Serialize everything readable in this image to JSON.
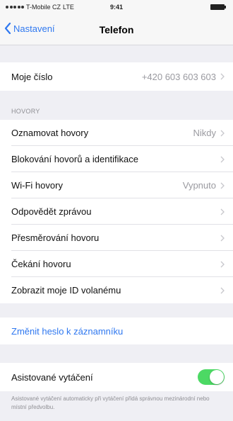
{
  "status": {
    "carrier": "T-Mobile CZ",
    "network": "LTE",
    "time": "9:41"
  },
  "nav": {
    "back_label": "Nastavení",
    "title": "Telefon"
  },
  "my_number": {
    "label": "Moje číslo",
    "value": "+420 603 603 603"
  },
  "calls_section": {
    "header": "HOVORY",
    "items": [
      {
        "label": "Oznamovat hovory",
        "value": "Nikdy"
      },
      {
        "label": "Blokování hovorů a identifikace",
        "value": ""
      },
      {
        "label": "Wi-Fi hovory",
        "value": "Vypnuto"
      },
      {
        "label": "Odpovědět zprávou",
        "value": ""
      },
      {
        "label": "Přesměrování hovoru",
        "value": ""
      },
      {
        "label": "Čekání hovoru",
        "value": ""
      },
      {
        "label": "Zobrazit moje ID volanému",
        "value": ""
      }
    ]
  },
  "voicemail": {
    "label": "Změnit heslo k záznamníku"
  },
  "assisted_dialing": {
    "label": "Asistované vytáčení",
    "enabled": true,
    "footnote": "Asistované vytáčení automaticky při vytáčení přidá správnou mezinárodní nebo místní předvolbu."
  },
  "colors": {
    "accent": "#2f78f0",
    "toggle_on": "#4cd964",
    "background": "#efeff4"
  }
}
